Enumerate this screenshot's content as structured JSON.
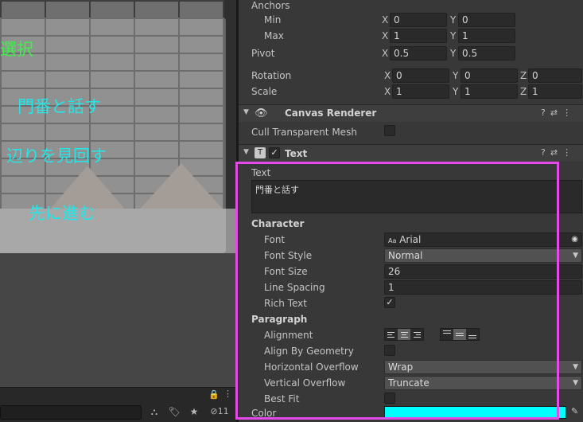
{
  "scene": {
    "select_label": "選択",
    "menu_items": [
      "門番と話す",
      "辺りを見回す",
      "先に進む"
    ],
    "toolbar": {
      "badge_count": "11"
    }
  },
  "inspector": {
    "anchors": {
      "title": "Anchors",
      "min": {
        "label": "Min",
        "x": "0",
        "y": "0"
      },
      "max": {
        "label": "Max",
        "x": "1",
        "y": "1"
      }
    },
    "pivot": {
      "label": "Pivot",
      "x": "0.5",
      "y": "0.5"
    },
    "rotation": {
      "label": "Rotation",
      "x": "0",
      "y": "0",
      "z": "0"
    },
    "scale": {
      "label": "Scale",
      "x": "1",
      "y": "1",
      "z": "1"
    },
    "axis": {
      "x": "X",
      "y": "Y",
      "z": "Z"
    },
    "canvas_renderer": {
      "title": "Canvas Renderer",
      "cull_label": "Cull Transparent Mesh",
      "cull_checked": false
    },
    "text_component": {
      "title": "Text",
      "enabled": true,
      "text_label": "Text",
      "text_value": "門番と話す",
      "character_header": "Character",
      "font_label": "Font",
      "font_value": "Arial",
      "font_icon": "Aa",
      "font_style_label": "Font Style",
      "font_style_value": "Normal",
      "font_size_label": "Font Size",
      "font_size_value": "26",
      "line_spacing_label": "Line Spacing",
      "line_spacing_value": "1",
      "rich_text_label": "Rich Text",
      "rich_text_checked": true,
      "paragraph_header": "Paragraph",
      "alignment_label": "Alignment",
      "align_by_geometry_label": "Align By Geometry",
      "h_overflow_label": "Horizontal Overflow",
      "h_overflow_value": "Wrap",
      "v_overflow_label": "Vertical Overflow",
      "v_overflow_value": "Truncate",
      "best_fit_label": "Best Fit",
      "color_label": "Color",
      "color_value": "#00ffff"
    }
  },
  "colors": {
    "highlight": "#e64ae6",
    "menu_text": "#23e6e6",
    "select_text": "#3df04a"
  }
}
